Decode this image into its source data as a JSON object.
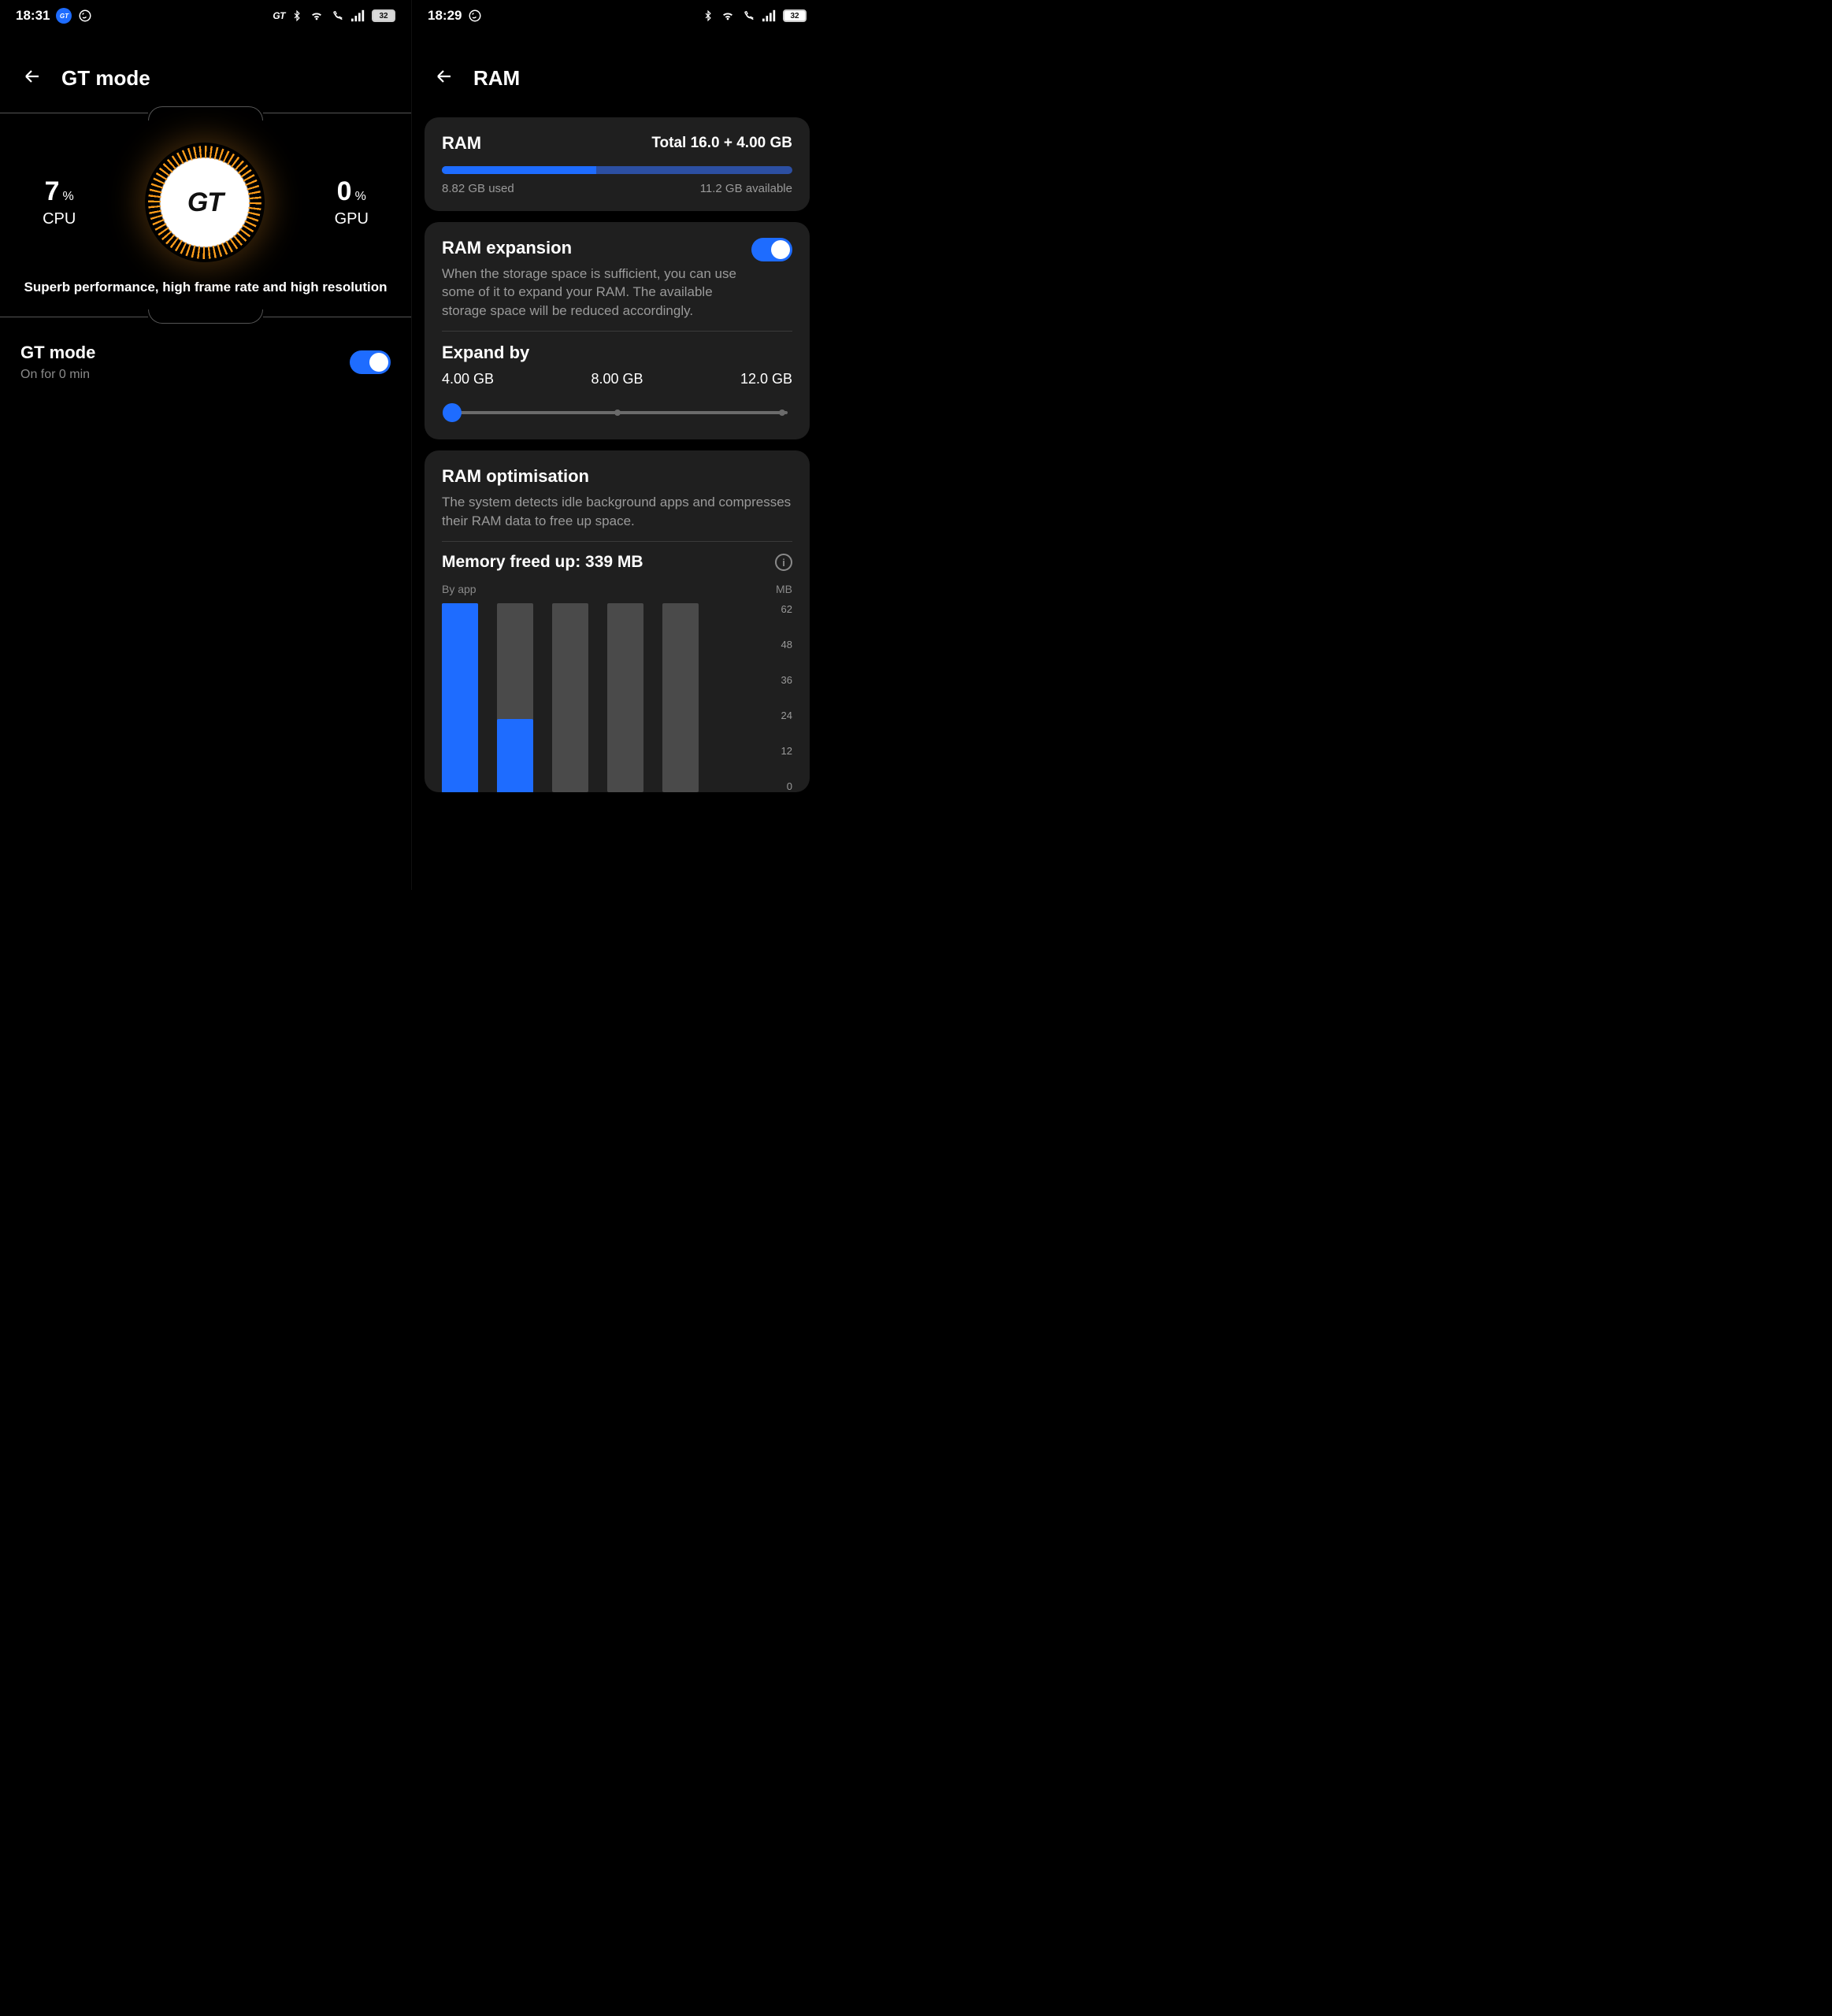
{
  "left": {
    "status": {
      "time": "18:31",
      "battery": "32",
      "gt_pill": "GT",
      "gt_text": "GT"
    },
    "title": "GT mode",
    "cpu": {
      "value": "7",
      "pct": "%",
      "label": "CPU"
    },
    "gpu": {
      "value": "0",
      "pct": "%",
      "label": "GPU"
    },
    "dial": "GT",
    "tagline": "Superb performance, high frame rate and high resolution",
    "row": {
      "title": "GT mode",
      "subtitle": "On for 0 min"
    }
  },
  "right": {
    "status": {
      "time": "18:29",
      "battery": "32"
    },
    "title": "RAM",
    "ram": {
      "label": "RAM",
      "total": "Total 16.0 + 4.00 GB",
      "used": "8.82 GB used",
      "available": "11.2 GB available",
      "used_pct": 44
    },
    "expansion": {
      "title": "RAM expansion",
      "desc": "When the storage space is sufficient, you can use some of it to expand your RAM. The available storage space will be reduced accordingly.",
      "expand_by": "Expand by",
      "options": [
        "4.00 GB",
        "8.00 GB",
        "12.0 GB"
      ],
      "selected_index": 0
    },
    "optim": {
      "title": "RAM optimisation",
      "desc": "The system detects idle background apps and compresses their RAM data to free up space.",
      "mem_line": "Memory freed up: 339 MB",
      "chart_head_left": "By app",
      "chart_head_right": "MB"
    }
  },
  "chart_data": {
    "type": "bar",
    "title": "Memory freed up by app",
    "xlabel": "By app",
    "ylabel": "MB",
    "y_ticks": [
      62,
      48,
      36,
      24,
      12,
      0
    ],
    "ylim": [
      0,
      62
    ],
    "bars": [
      {
        "total": 62,
        "value": 62
      },
      {
        "total": 62,
        "value": 24
      },
      {
        "total": 62,
        "value": 0
      },
      {
        "total": 62,
        "value": 0
      },
      {
        "total": 62,
        "value": 0
      }
    ]
  }
}
